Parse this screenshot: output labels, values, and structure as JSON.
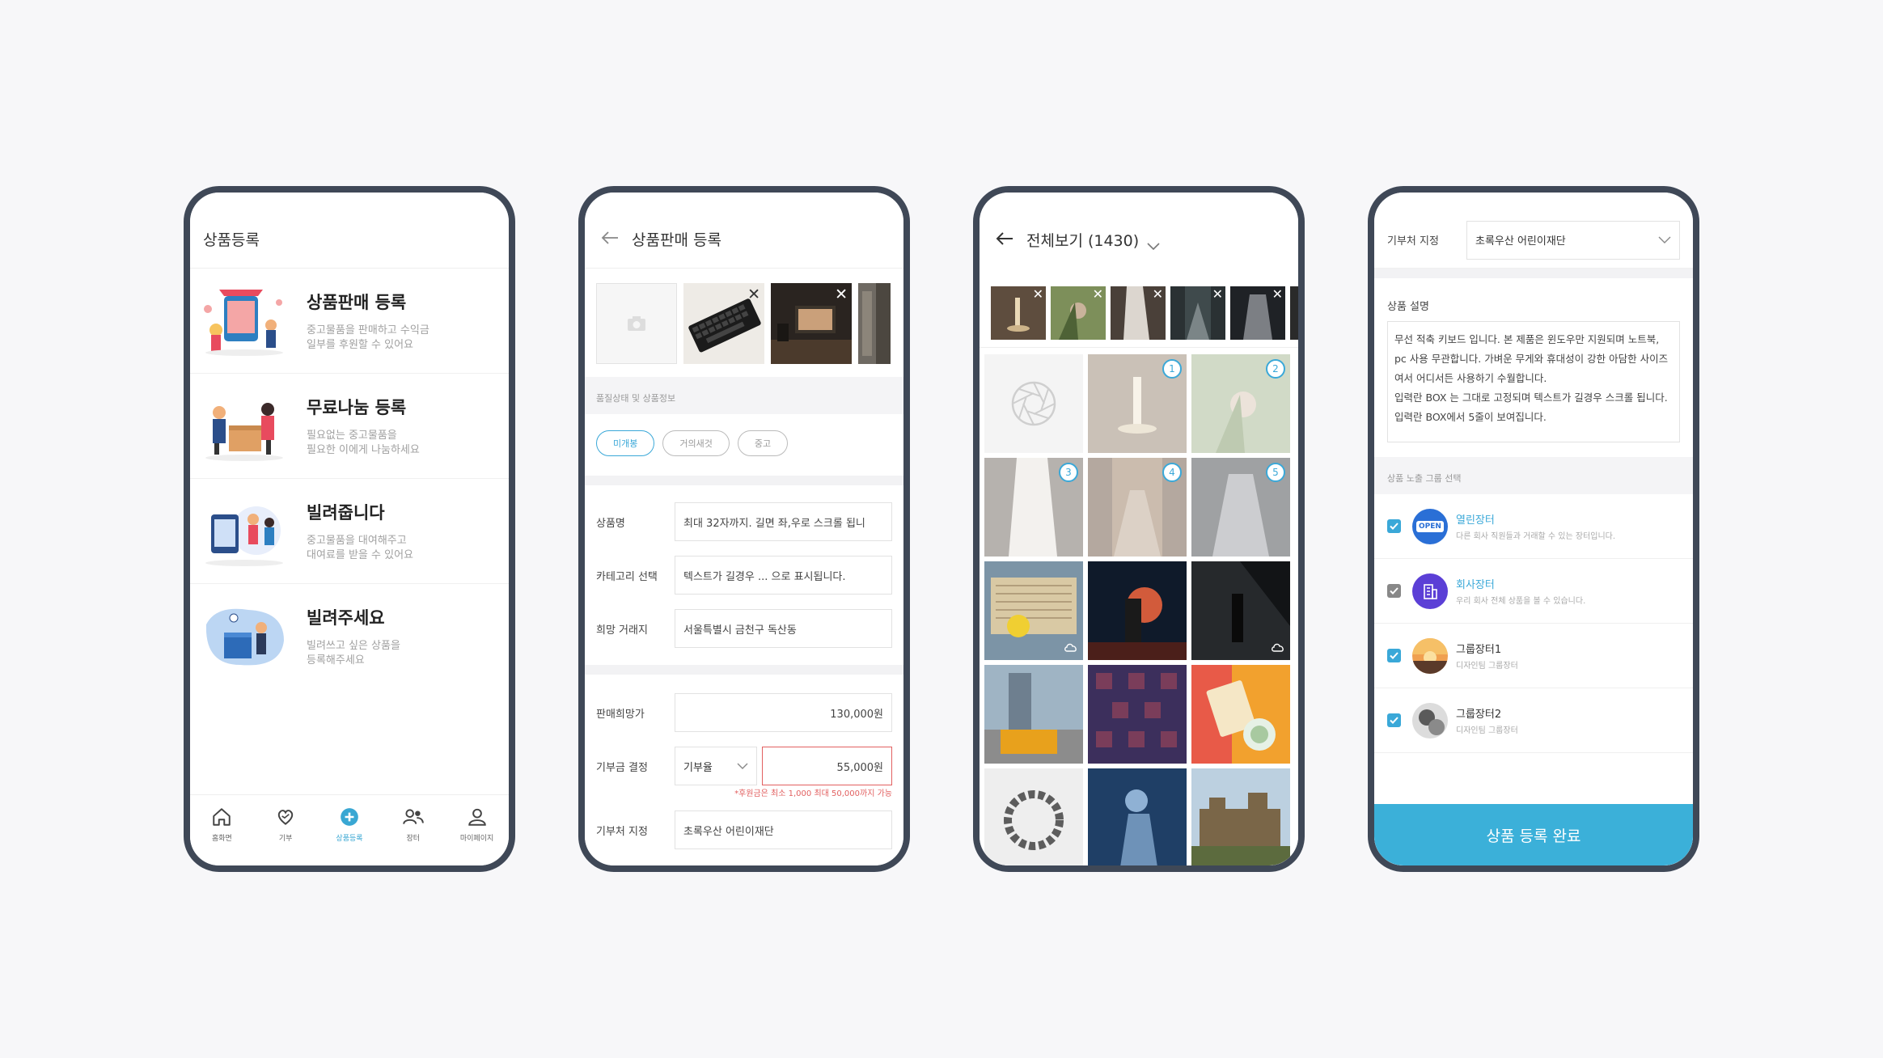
{
  "screen1": {
    "title": "상품등록",
    "items": [
      {
        "title": "상품판매 등록",
        "desc": "중고물품을 판매하고 수익금\n일부를 후원할 수 있어요"
      },
      {
        "title": "무료나눔 등록",
        "desc": "필요없는 중고물품을\n필요한 이에게 나눔하세요"
      },
      {
        "title": "빌려줍니다",
        "desc": "중고물품을 대여해주고\n대여료를 받을 수 있어요"
      },
      {
        "title": "빌려주세요",
        "desc": "빌려쓰고 싶은 상품을\n등록해주세요"
      }
    ],
    "tabs": [
      "홈화면",
      "기부",
      "상품등록",
      "장터",
      "마이페이지"
    ]
  },
  "screen2": {
    "title": "상품판매 등록",
    "condition_label": "품질상태 및 상품정보",
    "chips": [
      "미개봉",
      "거의새것",
      "중고"
    ],
    "fields": {
      "name_label": "상품명",
      "name_value": "최대 32자까지. 길면 좌,우로 스크롤 됩니",
      "category_label": "카테고리 선택",
      "category_value": "텍스트가 길경우 ... 으로 표시됩니다.",
      "place_label": "희망 거래지",
      "place_value": "서울특별시 금천구 독산동",
      "price_label": "판매희망가",
      "price_value": "130,000원",
      "donation_label": "기부금 결정",
      "donation_select": "기부율",
      "donation_value": "55,000원",
      "note": "*후원금은 최소 1,000 최대 50,000까지 가능",
      "partial_label": "기부처 지정",
      "partial_value": "초록우산 어린이재단"
    }
  },
  "screen3": {
    "title": "전체보기 (1430)",
    "numbers": [
      "1",
      "2",
      "3",
      "4",
      "5"
    ]
  },
  "screen4": {
    "donee_label": "기부처 지정",
    "donee_value": "초록우산 어린이재단",
    "desc_label": "상품 설명",
    "desc_text": "무선 적축 키보드 입니다. 본 제품은 윈도우만 지원되며 노트북, pc 사용 무관합니다. 가벼운 무게와 휴대성이 강한 아담한 사이즈여서 어디서든 사용하기 수월합니다.\n입력란 BOX 는 그대로 고정되며 텍스트가 길경우 스크롤 됩니다. 입력란 BOX에서 5줄이 보여집니다.",
    "group_label": "상품 노출 그룹 선택",
    "groups": [
      {
        "name": "열린장터",
        "desc": "다른 회사 직원들과 거래할 수 있는 장터입니다."
      },
      {
        "name": "회사장터",
        "desc": "우리 회사 전체 상품을 볼 수 있습니다."
      },
      {
        "name": "그룹장터1",
        "desc": "디자인팀 그룹장터"
      },
      {
        "name": "그룹장터2",
        "desc": "디자인팀 그룹장터"
      }
    ],
    "submit": "상품 등록 완료",
    "open_badge": "OPEN"
  },
  "colors": {
    "accent": "#3bb0d9",
    "frame": "#3f4857",
    "warn": "#e26060"
  }
}
